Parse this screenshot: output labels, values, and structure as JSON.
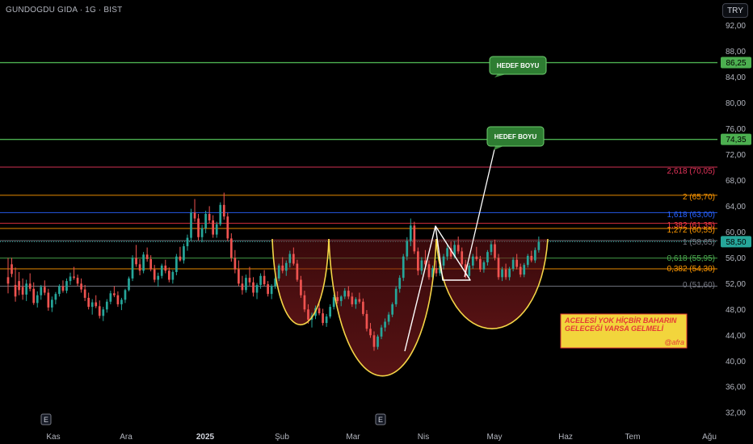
{
  "header": {
    "symbol_line": "GUNDOGDU GIDA · 1G · BIST",
    "currency_button": "TRY"
  },
  "chart_data": {
    "type": "candlestick",
    "title": "GUNDOGDU GIDA · 1G · BIST",
    "currency": "TRY",
    "y_ticks": [
      "92,00",
      "88,00",
      "84,00",
      "80,00",
      "76,00",
      "72,00",
      "68,00",
      "64,00",
      "60,00",
      "56,00",
      "52,00",
      "48,00",
      "44,00",
      "40,00",
      "36,00",
      "32,00"
    ],
    "y_tick_values": [
      92,
      88,
      84,
      80,
      76,
      72,
      68,
      64,
      60,
      56,
      52,
      48,
      44,
      40,
      36,
      32
    ],
    "ylim": [
      30.4,
      94.2
    ],
    "x_ticks": [
      {
        "label": "Kas",
        "bold": false
      },
      {
        "label": "Ara",
        "bold": false
      },
      {
        "label": "2025",
        "bold": true
      },
      {
        "label": "Şub",
        "bold": false
      },
      {
        "label": "Mar",
        "bold": false
      },
      {
        "label": "Nis",
        "bold": false
      },
      {
        "label": "May",
        "bold": false
      },
      {
        "label": "Haz",
        "bold": false
      },
      {
        "label": "Tem",
        "bold": false
      },
      {
        "label": "Ağu",
        "bold": false
      }
    ],
    "earnings_markers": [
      "E",
      "E"
    ],
    "price_labels": [
      {
        "label": "86,25",
        "value": 86.25,
        "color": "#4caf50"
      },
      {
        "label": "74,35",
        "value": 74.35,
        "color": "#4caf50"
      },
      {
        "label": "58,50",
        "value": 58.5,
        "color": "#26a69a"
      }
    ],
    "fib_levels": [
      {
        "label": "2,618 (70,05)",
        "value": 70.05,
        "color": "#e5345b"
      },
      {
        "label": "2 (65,70)",
        "value": 65.7,
        "color": "#ff9800"
      },
      {
        "label": "1,618 (63,00)",
        "value": 63.0,
        "color": "#2962ff"
      },
      {
        "label": "1,382 (61,35)",
        "value": 61.35,
        "color": "#f23645"
      },
      {
        "label": "1,272 (60,55)",
        "value": 60.55,
        "color": "#ff9800"
      },
      {
        "label": "1 (58,65)",
        "value": 58.65,
        "color": "#787b86"
      },
      {
        "label": "0,618 (55,95)",
        "value": 55.95,
        "color": "#4caf50"
      },
      {
        "label": "0,382 (54,30)",
        "value": 54.3,
        "color": "#ff9800"
      },
      {
        "label": "0 (51,60)",
        "value": 51.6,
        "color": "#787b86"
      }
    ],
    "target_lines": [
      {
        "value": 86.25,
        "color": "#4caf50"
      },
      {
        "value": 74.35,
        "color": "#4caf50"
      }
    ],
    "callouts": [
      {
        "label": "HEDEF BOYU"
      },
      {
        "label": "HEDEF BOYU"
      }
    ],
    "note": {
      "line1": "ACELESİ YOK HİÇBİR BAHARIN",
      "line2": "GELECEĞİ VARSA GELMELİ",
      "signature": "@afra"
    },
    "candles": [
      [
        53.0,
        56.0,
        50.5,
        52.0
      ],
      [
        55.0,
        56.0,
        53.0,
        53.5
      ],
      [
        51.8,
        54.5,
        49.2,
        50.0
      ],
      [
        52.4,
        53.8,
        50.2,
        51.0
      ],
      [
        51.5,
        52.8,
        49.5,
        50.3
      ],
      [
        50.3,
        52.6,
        49.3,
        52.0
      ],
      [
        52.0,
        53.6,
        50.8,
        51.2
      ],
      [
        51.2,
        52.2,
        48.7,
        49.0
      ],
      [
        49.0,
        50.8,
        48.3,
        50.2
      ],
      [
        50.2,
        51.8,
        49.5,
        51.5
      ],
      [
        51.5,
        52.5,
        50.2,
        50.6
      ],
      [
        50.6,
        51.2,
        47.8,
        48.3
      ],
      [
        48.3,
        50.0,
        47.6,
        49.5
      ],
      [
        49.5,
        50.7,
        48.8,
        50.4
      ],
      [
        50.4,
        51.9,
        50.0,
        51.6
      ],
      [
        51.6,
        52.5,
        50.6,
        50.9
      ],
      [
        50.9,
        52.8,
        50.5,
        52.4
      ],
      [
        52.4,
        53.7,
        51.8,
        53.1
      ],
      [
        53.1,
        54.6,
        52.6,
        52.9
      ],
      [
        52.9,
        53.4,
        51.6,
        52.0
      ],
      [
        52.0,
        52.8,
        50.6,
        51.1
      ],
      [
        51.1,
        51.8,
        49.3,
        49.8
      ],
      [
        49.8,
        50.6,
        48.0,
        48.4
      ],
      [
        48.4,
        49.6,
        47.2,
        49.1
      ],
      [
        49.1,
        50.2,
        48.2,
        48.5
      ],
      [
        48.5,
        49.4,
        46.6,
        47.0
      ],
      [
        47.0,
        48.4,
        46.2,
        48.0
      ],
      [
        48.0,
        49.6,
        47.5,
        49.2
      ],
      [
        49.2,
        50.9,
        48.8,
        50.5
      ],
      [
        50.5,
        51.6,
        49.9,
        50.2
      ],
      [
        50.2,
        50.8,
        48.4,
        48.8
      ],
      [
        48.8,
        49.8,
        47.9,
        49.5
      ],
      [
        49.5,
        51.2,
        49.0,
        51.0
      ],
      [
        51.0,
        53.1,
        50.8,
        52.8
      ],
      [
        52.8,
        56.4,
        52.4,
        56.0
      ],
      [
        56.0,
        58.0,
        54.6,
        55.0
      ],
      [
        55.0,
        55.8,
        53.3,
        54.0
      ],
      [
        54.0,
        56.9,
        53.6,
        56.5
      ],
      [
        56.5,
        57.6,
        55.4,
        55.8
      ],
      [
        55.8,
        56.4,
        53.9,
        54.2
      ],
      [
        54.2,
        54.9,
        52.2,
        52.6
      ],
      [
        52.6,
        53.7,
        51.5,
        53.2
      ],
      [
        53.2,
        55.1,
        52.8,
        54.8
      ],
      [
        54.8,
        55.7,
        53.6,
        54.0
      ],
      [
        54.0,
        54.5,
        52.2,
        52.6
      ],
      [
        52.6,
        54.1,
        52.0,
        53.8
      ],
      [
        53.8,
        56.6,
        53.3,
        56.2
      ],
      [
        56.2,
        57.7,
        55.4,
        55.6
      ],
      [
        55.6,
        58.2,
        55.1,
        57.8
      ],
      [
        57.8,
        59.6,
        57.1,
        59.1
      ],
      [
        59.1,
        63.6,
        58.6,
        63.0
      ],
      [
        63.0,
        65.1,
        61.6,
        62.1
      ],
      [
        62.1,
        62.8,
        58.7,
        59.2
      ],
      [
        59.2,
        61.1,
        58.4,
        60.6
      ],
      [
        60.6,
        63.3,
        59.8,
        62.8
      ],
      [
        62.8,
        64.0,
        61.4,
        61.8
      ],
      [
        61.8,
        62.6,
        59.1,
        59.6
      ],
      [
        59.6,
        61.6,
        59.1,
        61.2
      ],
      [
        61.2,
        64.6,
        60.9,
        64.2
      ],
      [
        64.2,
        66.1,
        61.9,
        62.4
      ],
      [
        62.4,
        63.0,
        58.6,
        59.0
      ],
      [
        59.0,
        59.8,
        55.4,
        56.0
      ],
      [
        56.0,
        57.2,
        53.6,
        54.2
      ],
      [
        54.2,
        55.6,
        51.6,
        52.0
      ],
      [
        52.0,
        53.2,
        50.3,
        51.0
      ],
      [
        51.0,
        53.4,
        50.6,
        52.9
      ],
      [
        52.9,
        54.6,
        51.7,
        52.2
      ],
      [
        52.2,
        53.0,
        50.0,
        50.6
      ],
      [
        50.6,
        52.1,
        49.6,
        51.8
      ],
      [
        51.8,
        53.6,
        51.2,
        53.2
      ],
      [
        53.2,
        54.1,
        51.6,
        51.9
      ],
      [
        51.9,
        52.4,
        50.0,
        50.4
      ],
      [
        50.4,
        51.9,
        49.6,
        51.6
      ],
      [
        51.6,
        53.1,
        51.2,
        52.8
      ],
      [
        52.8,
        55.1,
        52.4,
        54.8
      ],
      [
        54.8,
        56.1,
        53.6,
        54.0
      ],
      [
        54.0,
        55.6,
        53.2,
        55.2
      ],
      [
        55.2,
        57.1,
        54.5,
        56.6
      ],
      [
        56.6,
        57.6,
        54.8,
        55.1
      ],
      [
        55.1,
        55.7,
        52.3,
        52.6
      ],
      [
        52.6,
        53.2,
        49.8,
        50.2
      ],
      [
        50.2,
        50.9,
        47.6,
        48.0
      ],
      [
        48.0,
        48.8,
        45.8,
        46.4
      ],
      [
        46.4,
        47.5,
        45.2,
        47.0
      ],
      [
        47.0,
        48.6,
        46.5,
        48.2
      ],
      [
        48.2,
        49.2,
        47.1,
        47.4
      ],
      [
        47.4,
        48.1,
        45.5,
        45.9
      ],
      [
        45.9,
        47.3,
        45.3,
        46.9
      ],
      [
        46.9,
        48.8,
        46.6,
        48.4
      ],
      [
        48.4,
        50.3,
        48.0,
        49.9
      ],
      [
        49.9,
        50.8,
        48.9,
        49.3
      ],
      [
        49.3,
        50.2,
        48.5,
        50.0
      ],
      [
        50.0,
        51.3,
        49.6,
        50.9
      ],
      [
        50.9,
        51.6,
        49.6,
        50.0
      ],
      [
        50.0,
        50.6,
        48.4,
        48.8
      ],
      [
        48.8,
        49.9,
        48.1,
        49.6
      ],
      [
        49.6,
        50.6,
        48.9,
        49.2
      ],
      [
        49.2,
        49.7,
        47.0,
        47.3
      ],
      [
        47.3,
        47.9,
        44.6,
        45.0
      ],
      [
        45.0,
        45.9,
        43.6,
        44.0
      ],
      [
        44.0,
        44.6,
        41.6,
        42.2
      ],
      [
        42.2,
        44.1,
        41.8,
        43.8
      ],
      [
        43.8,
        45.6,
        43.4,
        45.2
      ],
      [
        45.2,
        46.6,
        44.6,
        46.1
      ],
      [
        46.1,
        47.6,
        45.6,
        47.2
      ],
      [
        47.2,
        49.1,
        46.8,
        48.8
      ],
      [
        48.8,
        51.6,
        48.4,
        51.2
      ],
      [
        51.2,
        53.3,
        50.6,
        52.9
      ],
      [
        52.9,
        56.6,
        52.4,
        56.2
      ],
      [
        56.2,
        59.2,
        55.6,
        58.6
      ],
      [
        58.6,
        62.1,
        57.8,
        61.0
      ],
      [
        61.0,
        61.6,
        56.6,
        57.0
      ],
      [
        57.0,
        57.6,
        53.3,
        54.0
      ],
      [
        54.0,
        56.1,
        53.4,
        55.6
      ],
      [
        55.6,
        57.2,
        54.6,
        55.0
      ],
      [
        55.0,
        55.6,
        52.6,
        53.0
      ],
      [
        53.0,
        54.8,
        52.5,
        54.4
      ],
      [
        54.4,
        55.6,
        53.1,
        53.6
      ],
      [
        53.6,
        55.1,
        53.2,
        54.8
      ],
      [
        54.8,
        56.6,
        54.2,
        56.2
      ],
      [
        56.2,
        58.1,
        55.6,
        57.5
      ],
      [
        57.5,
        58.5,
        55.8,
        56.2
      ],
      [
        56.2,
        58.6,
        55.9,
        58.0
      ],
      [
        58.0,
        59.3,
        56.6,
        57.0
      ],
      [
        57.0,
        57.6,
        54.6,
        55.0
      ],
      [
        55.0,
        55.7,
        52.8,
        53.2
      ],
      [
        53.2,
        55.2,
        52.8,
        54.8
      ],
      [
        54.8,
        56.6,
        54.3,
        56.2
      ],
      [
        56.2,
        57.7,
        55.5,
        55.8
      ],
      [
        55.8,
        56.3,
        53.8,
        54.2
      ],
      [
        54.2,
        55.6,
        53.7,
        55.3
      ],
      [
        55.3,
        57.2,
        54.8,
        56.9
      ],
      [
        56.9,
        58.6,
        56.4,
        58.1
      ],
      [
        58.1,
        58.8,
        55.6,
        56.0
      ],
      [
        56.0,
        56.6,
        52.6,
        53.0
      ],
      [
        53.0,
        54.6,
        52.4,
        54.2
      ],
      [
        54.2,
        55.1,
        52.6,
        53.0
      ],
      [
        53.0,
        54.6,
        52.5,
        54.3
      ],
      [
        54.3,
        56.1,
        53.9,
        55.7
      ],
      [
        55.7,
        56.6,
        54.2,
        54.6
      ],
      [
        54.6,
        55.1,
        53.0,
        53.4
      ],
      [
        53.4,
        55.2,
        53.0,
        54.9
      ],
      [
        54.9,
        56.6,
        54.5,
        56.3
      ],
      [
        56.3,
        57.1,
        55.3,
        55.6
      ],
      [
        55.6,
        57.6,
        55.2,
        57.2
      ],
      [
        57.2,
        59.3,
        56.8,
        58.5
      ]
    ]
  }
}
